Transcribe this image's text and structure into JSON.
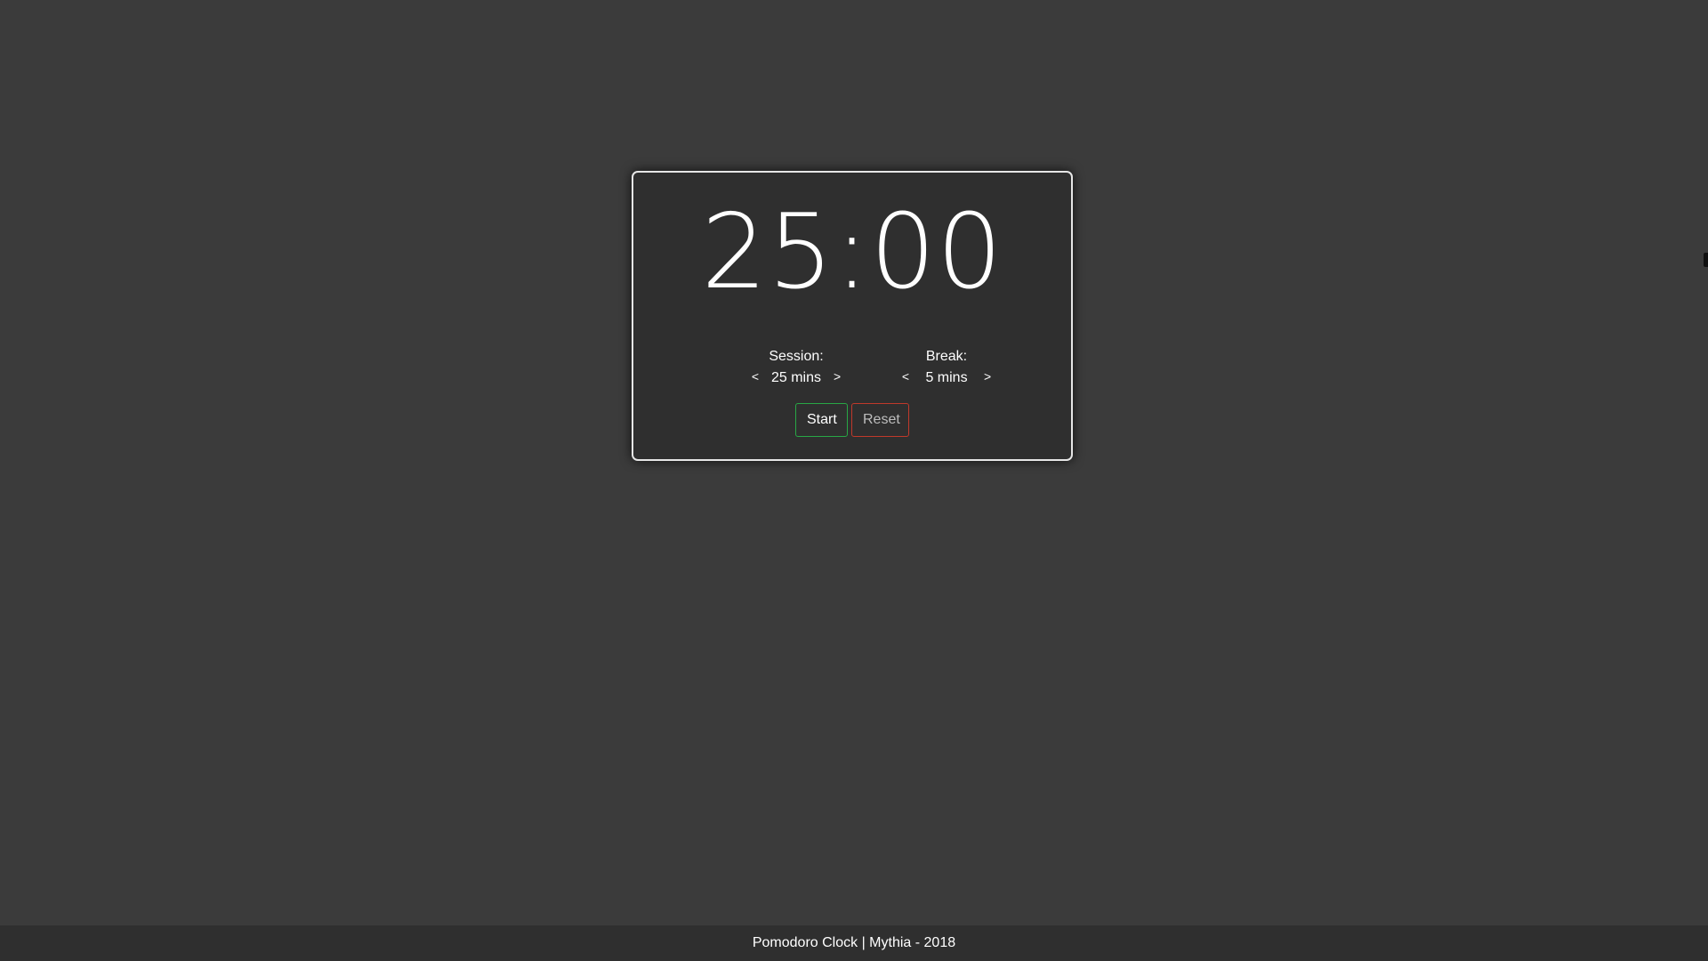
{
  "clock": {
    "time": "25:00"
  },
  "session": {
    "label": "Session:",
    "value": "25 mins",
    "decrement": "<",
    "increment": ">"
  },
  "break": {
    "label": "Break:",
    "value": "5 mins",
    "decrement": "<",
    "increment": ">"
  },
  "controls": {
    "start_label": "Start",
    "reset_label": "Reset"
  },
  "footer": {
    "text": "Pomodoro Clock | Mythia - 2018"
  },
  "colors": {
    "background": "#3b3b3b",
    "card": "#2f2f2f",
    "start_border": "#28a745",
    "reset_border": "#c0392b"
  }
}
